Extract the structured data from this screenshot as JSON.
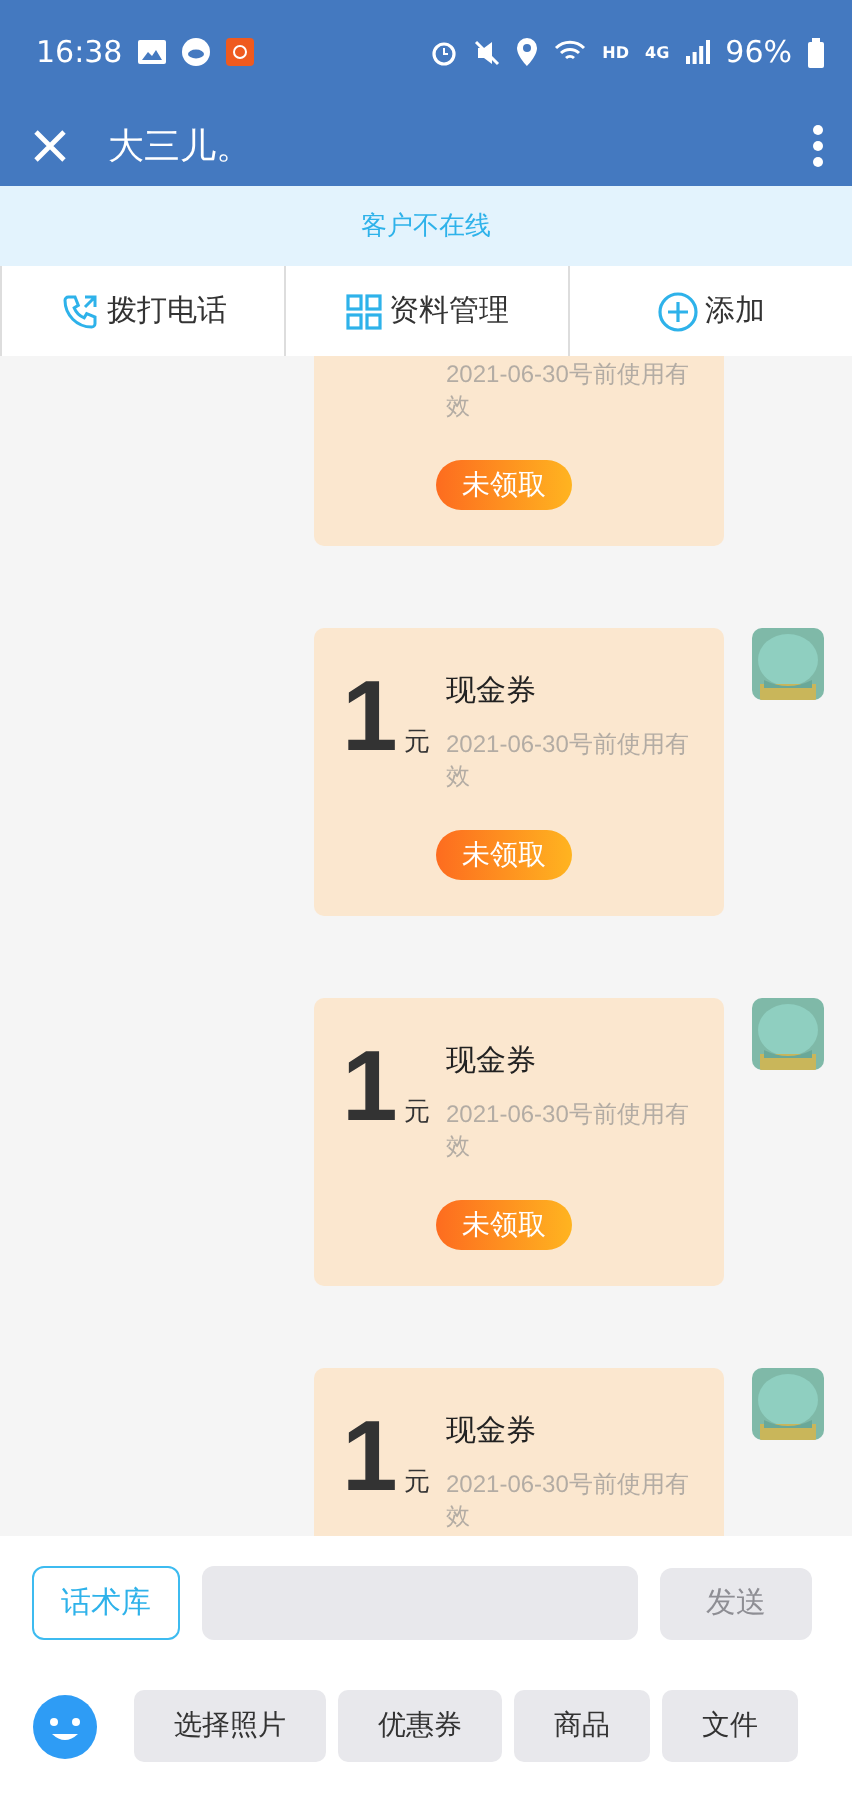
{
  "status_bar": {
    "time": "16:38",
    "network": "HD",
    "cellular": "4G",
    "battery": "96%"
  },
  "app_bar": {
    "title": "大三儿。"
  },
  "banner": {
    "text": "客户不在线"
  },
  "actions": [
    {
      "kind": "phone",
      "label": "拨打电话"
    },
    {
      "kind": "grid",
      "label": "资料管理"
    },
    {
      "kind": "add",
      "label": "添加"
    }
  ],
  "messages": [
    {
      "expiry": "2021-06-30号前使用有效",
      "button": "未领取"
    },
    {
      "amount": "1",
      "unit": "元",
      "title": "现金券",
      "expiry": "2021-06-30号前使用有效",
      "button": "未领取"
    },
    {
      "amount": "1",
      "unit": "元",
      "title": "现金券",
      "expiry": "2021-06-30号前使用有效",
      "button": "未领取"
    },
    {
      "amount": "1",
      "unit": "元",
      "title": "现金券",
      "expiry": "2021-06-30号前使用有效"
    }
  ],
  "composer": {
    "phrases_button": "话术库",
    "send_button": "发送",
    "send_disabled": true
  },
  "tools": [
    "选择照片",
    "优惠券",
    "商品",
    "文件"
  ]
}
